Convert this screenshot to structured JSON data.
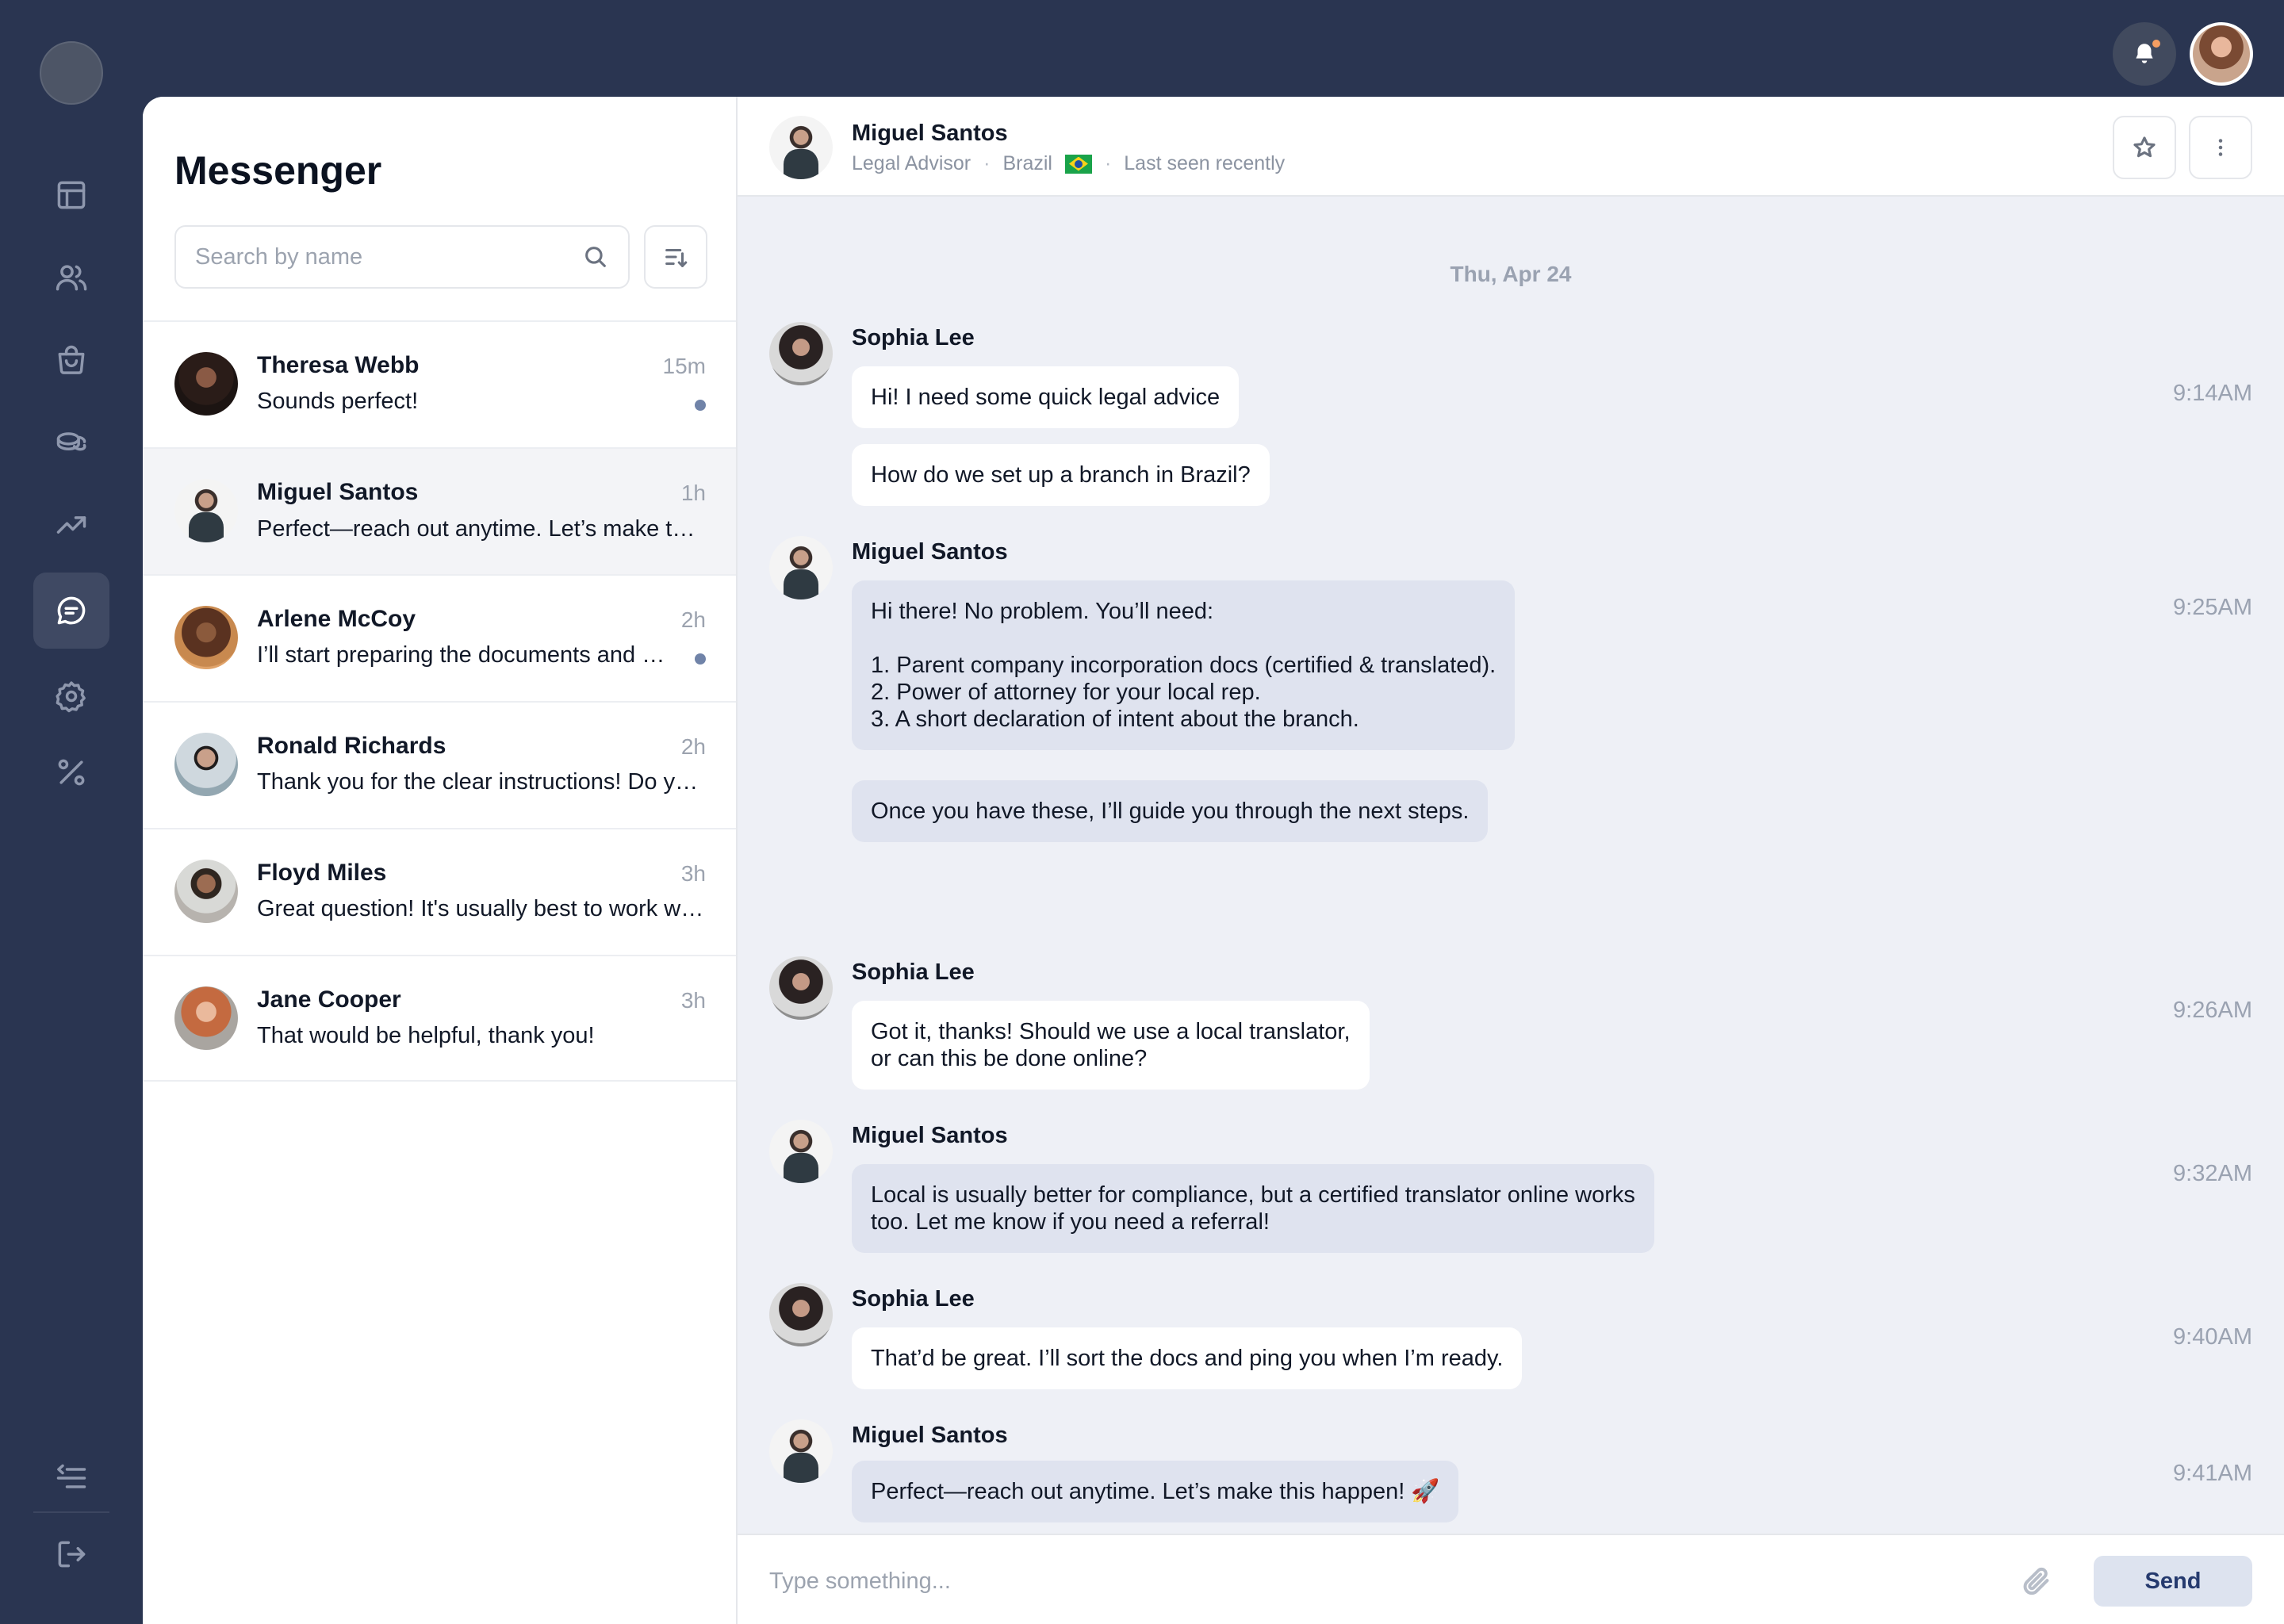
{
  "app": {
    "title": "Messenger"
  },
  "search": {
    "placeholder": "Search by name",
    "value": ""
  },
  "conversations": [
    {
      "name": "Theresa Webb",
      "time": "15m",
      "preview": "Sounds perfect!",
      "unread": true,
      "avatar": "theresa"
    },
    {
      "name": "Miguel Santos",
      "time": "1h",
      "preview": "Perfect—reach out anytime. Let’s make this happen! 🚀",
      "unread": false,
      "active": true,
      "avatar": "miguel"
    },
    {
      "name": "Arlene McCoy",
      "time": "2h",
      "preview": "I’ll start preparing the documents and get back to you.",
      "unread": true,
      "avatar": "arlene"
    },
    {
      "name": "Ronald Richards",
      "time": "2h",
      "preview": "Thank you for the clear instructions! Do you have a template?",
      "unread": false,
      "avatar": "ronald"
    },
    {
      "name": "Floyd Miles",
      "time": "3h",
      "preview": "Great question! It's usually best to work with a local expert.",
      "unread": false,
      "avatar": "floyd"
    },
    {
      "name": "Jane Cooper",
      "time": "3h",
      "preview": "That would be helpful, thank you!",
      "unread": false,
      "avatar": "jane"
    }
  ],
  "chat": {
    "contact": {
      "name": "Miguel Santos",
      "role": "Legal Advisor",
      "country": "Brazil",
      "status": "Last seen recently"
    },
    "date": "Thu, Apr 24",
    "groups": [
      {
        "sender": "Sophia Lee",
        "time": "9:14AM",
        "avatar": "sophia",
        "direction": "in",
        "messages": [
          "Hi! I need some quick legal advice",
          "How do we set up a branch in Brazil?"
        ]
      },
      {
        "sender": "Miguel Santos",
        "time": "9:25AM",
        "avatar": "miguel",
        "direction": "out",
        "messages": [
          "Hi there! No problem. You’ll need:\n\n1. Parent company incorporation docs (certified & translated).\n2. Power of attorney for your local rep.\n3. A short declaration of intent about the branch.",
          "Once you have these, I’ll guide you through the next steps."
        ]
      },
      {
        "sender": "Sophia Lee",
        "time": "9:26AM",
        "avatar": "sophia",
        "direction": "in",
        "messages": [
          "Got it, thanks! Should we use a local translator,\nor can this be done online?"
        ]
      },
      {
        "sender": "Miguel Santos",
        "time": "9:32AM",
        "avatar": "miguel",
        "direction": "out",
        "messages": [
          "Local is usually better for compliance, but a certified translator online works\ntoo. Let me know if you need a referral!"
        ]
      },
      {
        "sender": "Sophia Lee",
        "time": "9:40AM",
        "avatar": "sophia",
        "direction": "in",
        "messages": [
          "That’d be great. I’ll sort the docs and ping you when I’m ready."
        ]
      },
      {
        "sender": "Miguel Santos",
        "time": "9:41AM",
        "avatar": "miguel",
        "direction": "out",
        "messages": [
          "Perfect—reach out anytime. Let’s make this happen! 🚀"
        ]
      }
    ]
  },
  "composer": {
    "placeholder": "Type something...",
    "value": "",
    "send_label": "Send"
  },
  "nav": {
    "items": [
      "dashboard-icon",
      "users-icon",
      "briefcase-icon",
      "coins-icon",
      "trending-up-icon",
      "chat-icon",
      "settings-icon",
      "percent-icon"
    ],
    "active": "chat-icon",
    "bottom": [
      "collapse-menu-icon",
      "logout-icon"
    ]
  },
  "colors": {
    "sidebar": "#2a3551",
    "chat_bg": "#eef0f6",
    "outgoing_bubble": "#dfe3ef",
    "incoming_bubble": "#ffffff",
    "unread_dot": "#7083a8",
    "send_text": "#253a6e"
  }
}
